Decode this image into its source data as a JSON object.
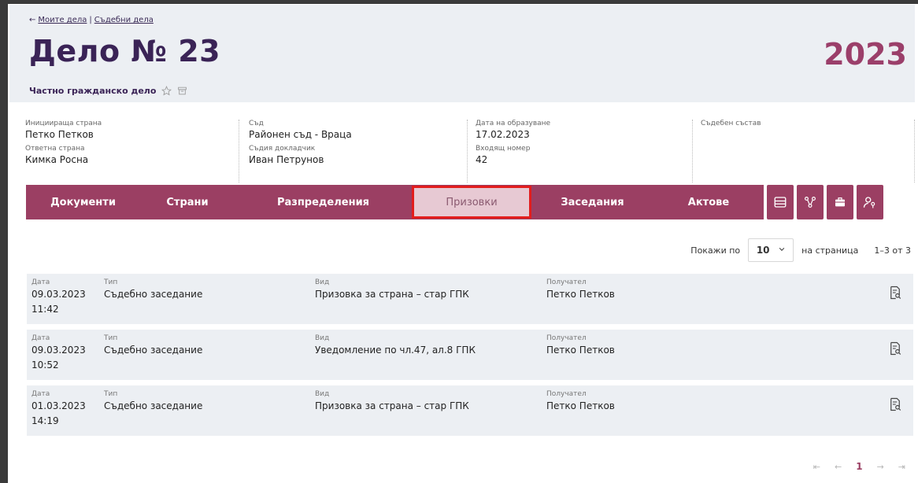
{
  "breadcrumb": {
    "back_arrow": "←",
    "link1": "Моите дела",
    "separator": "|",
    "link2": "Съдебни дела"
  },
  "case": {
    "title": "Дело № 23",
    "year": "2023",
    "type": "Частно гражданско дело"
  },
  "info": {
    "col1": {
      "label1": "Инициираща страна",
      "value1": "Петко Петков",
      "label2": "Ответна страна",
      "value2": "Кимка Росна"
    },
    "col2": {
      "label1": "Съд",
      "value1": "Районен съд - Враца",
      "label2": "Съдия докладчик",
      "value2": "Иван Петрунов"
    },
    "col3": {
      "label1": "Дата на образуване",
      "value1": "17.02.2023",
      "label2": "Входящ номер",
      "value2": "42"
    },
    "col4": {
      "label1": "Съдебен състав"
    }
  },
  "tabs": [
    {
      "label": "Документи"
    },
    {
      "label": "Страни"
    },
    {
      "label": "Разпределения"
    },
    {
      "label": "Призовки"
    },
    {
      "label": "Заседания"
    },
    {
      "label": "Актове"
    }
  ],
  "icon_tabs": [
    "list-icon",
    "network-icon",
    "briefcase-icon",
    "user-key-icon"
  ],
  "pager": {
    "show_label": "Покажи по",
    "page_size": "10",
    "per_page_label": "на страница",
    "range": "1–3 от 3",
    "current_page": "1"
  },
  "columns": {
    "date": "Дата",
    "type": "Тип",
    "kind": "Вид",
    "recipient": "Получател"
  },
  "rows": [
    {
      "date": "09.03.2023",
      "time": "11:42",
      "type": "Съдебно заседание",
      "kind": "Призовка за страна – стар ГПК",
      "recipient": "Петко Петков"
    },
    {
      "date": "09.03.2023",
      "time": "10:52",
      "type": "Съдебно заседание",
      "kind": "Уведомление по чл.47, ал.8 ГПК",
      "recipient": "Петко Петков"
    },
    {
      "date": "01.03.2023",
      "time": "14:19",
      "type": "Съдебно заседание",
      "kind": "Призовка за страна – стар ГПК",
      "recipient": "Петко Петков"
    }
  ],
  "colors": {
    "accent": "#9b3f63",
    "title": "#3a2356",
    "year": "#9b3f6a",
    "highlight": "#e21d1d"
  }
}
